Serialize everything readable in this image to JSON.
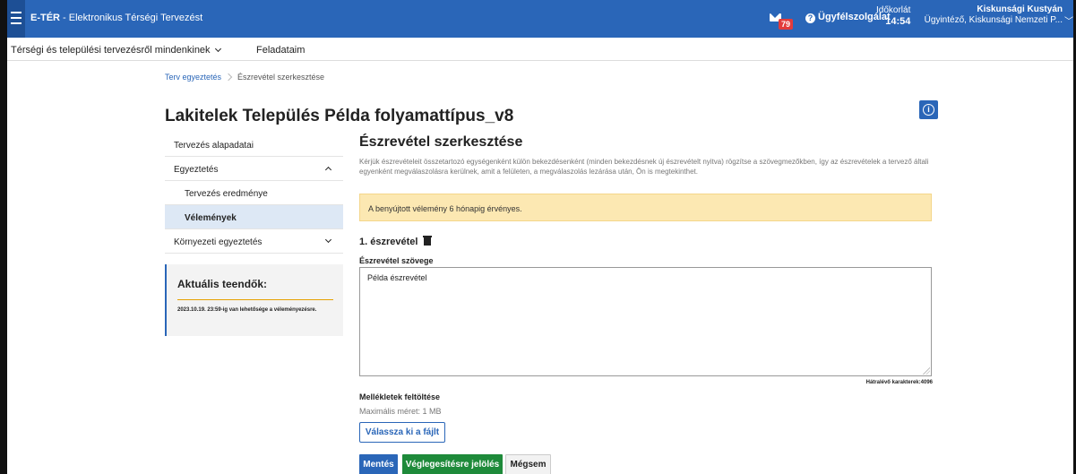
{
  "topbar": {
    "brand": "E-TÉR",
    "subtitle": " - Elektronikus Térségi Tervezést",
    "message_count": "79",
    "help_label": "Ügyfélszolgálat",
    "timelimit_label": "Időkorlát",
    "timelimit_value": "14:54",
    "user_name": "Kiskunsági Kustyán",
    "user_role": "Ügyintéző, Kiskunsági Nemzeti P..."
  },
  "nav": {
    "item1": "Térségi és települési tervezésről mindenkinek",
    "item2": "Feladataim"
  },
  "breadcrumb": {
    "root": "Terv egyeztetés",
    "current": "Észrevétel szerkesztése"
  },
  "page_title": "Lakitelek Település Példa folyamattípus_v8",
  "sidebar": {
    "items": [
      "Tervezés alapadatai",
      "Egyeztetés",
      "Tervezés eredménye",
      "Vélemények",
      "Környezeti egyeztetés"
    ],
    "todo_title": "Aktuális teendők:",
    "todo_text": "2023.10.19. 23:59-ig van lehetősége a véleményezésre."
  },
  "main": {
    "heading": "Észrevétel szerkesztése",
    "intro": "Kérjük észrevételeit összetartozó egységenként külön bekezdésenként (minden bekezdésnek új észrevételt nyitva) rögzítse a szövegmezőkben, így az észrevételek a tervező általi egyenként megválaszolásra kerülnek, amit a felületen, a megválaszolás lezárása után, Ön is megtekinthet.",
    "alert": "A benyújtott vélemény 6 hónapig érvényes.",
    "obs_title": "1. észrevétel",
    "field_label": "Észrevétel szövege",
    "text_value": "Példa észrevétel",
    "remaining": "Hátralévő karakterek:4096",
    "upload_label": "Mellékletek feltöltése",
    "upload_hint": "Maximális méret: 1 MB",
    "file_button": "Válassza ki a fájlt",
    "save": "Mentés",
    "finalize": "Véglegesítésre jelölés",
    "cancel": "Mégsem"
  }
}
